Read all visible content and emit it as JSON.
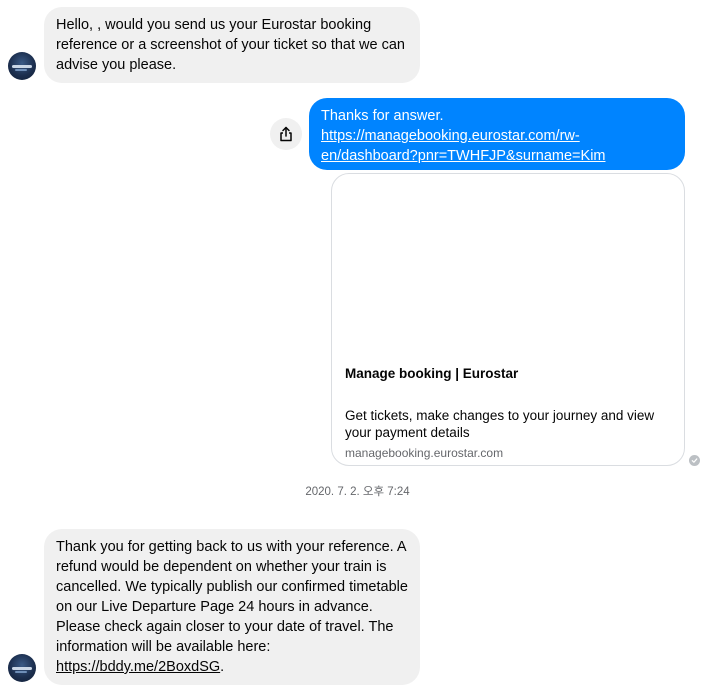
{
  "messages": {
    "first_incoming": "Hello, , would you send us your Eurostar booking reference or a screenshot of your ticket so that we can advise you please.",
    "outgoing": {
      "text": "Thanks for answer.",
      "link_line1": "https://managebooking.eurostar.com/rw-",
      "link_line2": "en/dashboard?pnr=TWHFJP&surname=Kim"
    },
    "link_preview": {
      "title": "Manage booking | Eurostar",
      "description": "Get tickets, make changes to your journey and view your payment details",
      "domain": "managebooking.eurostar.com"
    },
    "timestamp": "2020. 7. 2. 오후 7:24",
    "second_incoming": {
      "text": "Thank you for getting back to us with your reference. A refund would be dependent on whether your train is cancelled. We typically publish our confirmed timetable on our Live Departure Page 24 hours in advance. Please check again closer to your date of travel. The information will be available here:",
      "link": "https://bddy.me/2BoxdSG",
      "trailing": "."
    }
  },
  "icons": {
    "share": "share-icon",
    "seen": "seen-check-icon",
    "avatar": "contact-avatar"
  },
  "colors": {
    "outgoing_bubble": "#0084ff",
    "incoming_bubble": "#f0f0f0",
    "muted_text": "#65676b"
  }
}
